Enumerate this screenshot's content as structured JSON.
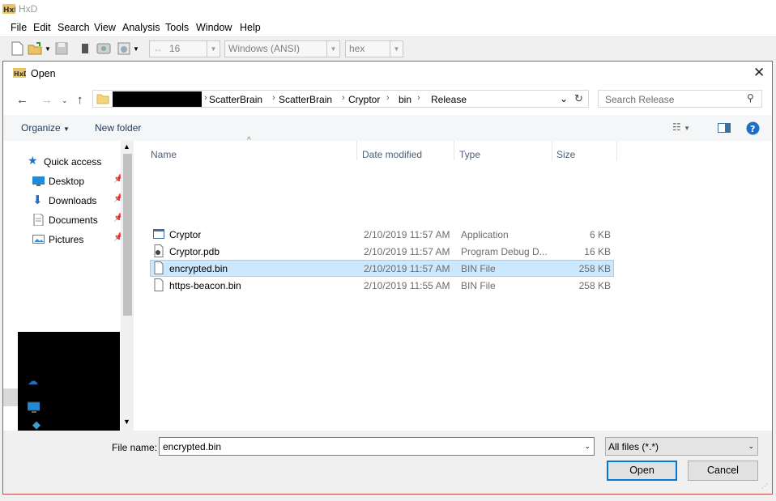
{
  "app": {
    "title": "HxD",
    "menu": [
      "File",
      "Edit",
      "Search",
      "View",
      "Analysis",
      "Tools",
      "Window",
      "Help"
    ],
    "toolbar": {
      "bytes_per_row": "16",
      "charset": "Windows (ANSI)",
      "offset_base": "hex"
    }
  },
  "dialog": {
    "title": "Open",
    "breadcrumb": [
      "ScatterBrain",
      "ScatterBrain",
      "Cryptor",
      "bin",
      "Release"
    ],
    "search_placeholder": "Search Release",
    "commands": {
      "organize": "Organize",
      "new_folder": "New folder"
    },
    "nav": {
      "quick_access": "Quick access",
      "items": [
        {
          "label": "Desktop",
          "icon": "desktop-icon",
          "pinned": true
        },
        {
          "label": "Downloads",
          "icon": "downloads-icon",
          "pinned": true
        },
        {
          "label": "Documents",
          "icon": "documents-icon",
          "pinned": true
        },
        {
          "label": "Pictures",
          "icon": "pictures-icon",
          "pinned": true
        }
      ],
      "onedrive": "OneDrive",
      "this_pc": "This PC",
      "objects_3d": "3D Objects"
    },
    "columns": {
      "name": "Name",
      "date": "Date modified",
      "type": "Type",
      "size": "Size"
    },
    "files": [
      {
        "name": "Cryptor",
        "date": "2/10/2019 11:57 AM",
        "type": "Application",
        "size": "6 KB",
        "icon": "application-icon",
        "selected": false
      },
      {
        "name": "Cryptor.pdb",
        "date": "2/10/2019 11:57 AM",
        "type": "Program Debug D...",
        "size": "16 KB",
        "icon": "pdb-file-icon",
        "selected": false
      },
      {
        "name": "encrypted.bin",
        "date": "2/10/2019 11:57 AM",
        "type": "BIN File",
        "size": "258 KB",
        "icon": "file-icon",
        "selected": true
      },
      {
        "name": "https-beacon.bin",
        "date": "2/10/2019 11:55 AM",
        "type": "BIN File",
        "size": "258 KB",
        "icon": "file-icon",
        "selected": false
      }
    ],
    "file_name_label": "File name:",
    "file_name_value": "encrypted.bin",
    "filter_value": "All files (*.*)",
    "open_label": "Open",
    "cancel_label": "Cancel",
    "colors": {
      "selection_bg": "#cce8ff",
      "selection_border": "#99d1ff",
      "accent": "#0078d7",
      "dialog_border": "#c84a4a"
    }
  }
}
